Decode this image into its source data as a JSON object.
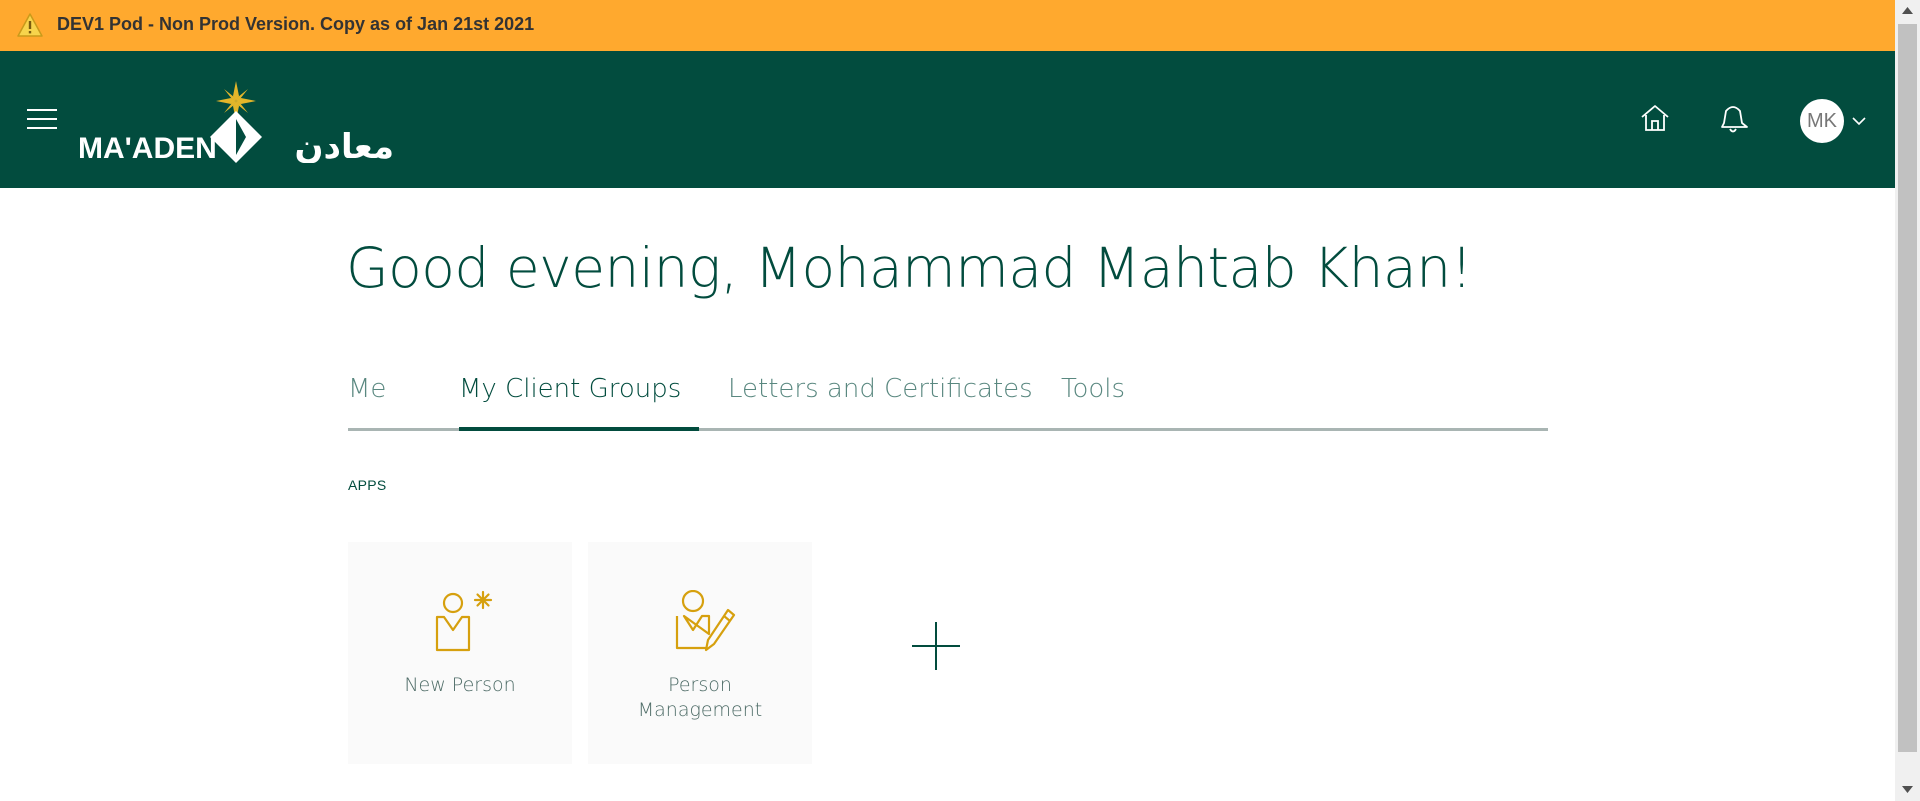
{
  "banner": {
    "text": "DEV1 Pod - Non Prod Version. Copy as of Jan 21st 2021",
    "icon": "warning-icon",
    "color": "#ffa92e"
  },
  "header": {
    "color": "#024c3e",
    "menu_icon": "hamburger-menu-icon",
    "logo_text_latin": "MA'ADEN",
    "logo_text_arabic": "معادن",
    "home_icon": "home-icon",
    "notifications_icon": "bell-icon",
    "avatar_initials": "MK"
  },
  "greeting": "Good evening, Mohammad Mahtab Khan!",
  "tabs": [
    {
      "label": "Me",
      "active": false
    },
    {
      "label": "My Client Groups",
      "active": true
    },
    {
      "label": "Letters and Certificates",
      "active": false
    },
    {
      "label": "Tools",
      "active": false
    }
  ],
  "apps": {
    "label": "APPS",
    "tiles": [
      {
        "label": "New Person",
        "icon": "new-person-icon"
      },
      {
        "label": "Person Management",
        "icon": "person-management-icon"
      }
    ],
    "add_icon": "plus-icon"
  },
  "colors": {
    "accent": "#024c3e",
    "icon_gold": "#d6a00e",
    "tab_inactive": "#5a8880"
  }
}
